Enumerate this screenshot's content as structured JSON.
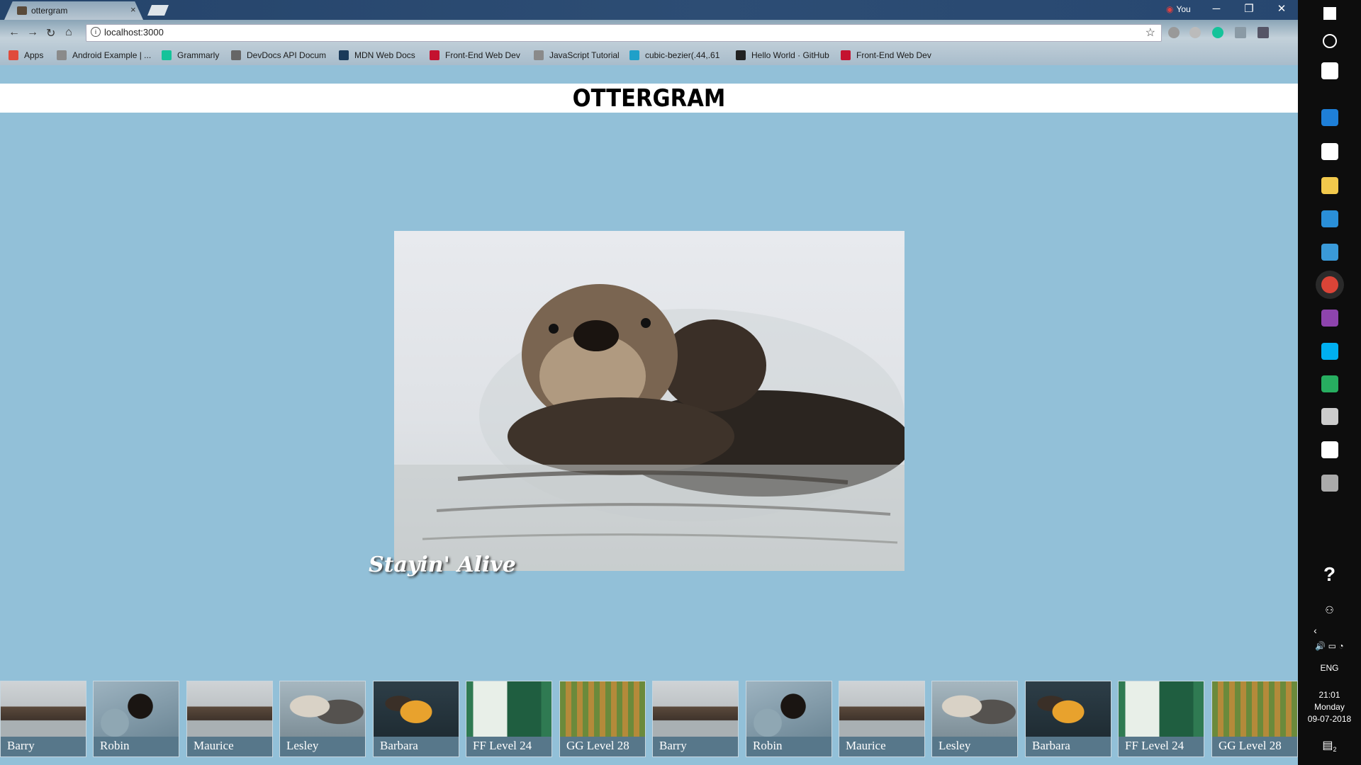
{
  "browser": {
    "tab_title": "ottergram",
    "tab_close": "×",
    "profile": "You",
    "url": "localhost:3000",
    "window_controls": [
      "─",
      "❐",
      "✕"
    ],
    "bookmarks": [
      {
        "label": "Apps",
        "icon": "apps-grid-icon",
        "color": "#e04b3c"
      },
      {
        "label": "Android Example | ...",
        "icon": "page-icon",
        "color": "#8a8a8a"
      },
      {
        "label": "Grammarly",
        "icon": "grammarly-icon",
        "color": "#15c39a"
      },
      {
        "label": "DevDocs API Docum",
        "icon": "devdocs-icon",
        "color": "#666666"
      },
      {
        "label": "MDN Web Docs",
        "icon": "mdn-icon",
        "color": "#1a3a5a"
      },
      {
        "label": "Front-End Web Dev",
        "icon": "bnr-icon",
        "color": "#c4122f"
      },
      {
        "label": "JavaScript Tutorial",
        "icon": "page-icon",
        "color": "#8a8a8a"
      },
      {
        "label": "cubic-bezier(.44,.61",
        "icon": "cubic-icon",
        "color": "#1fa0c9"
      },
      {
        "label": "Hello World · GitHub",
        "icon": "github-icon",
        "color": "#222222"
      },
      {
        "label": "Front-End Web Dev",
        "icon": "bnr-icon",
        "color": "#c4122f"
      }
    ]
  },
  "page": {
    "logo": "OTTERGRAM",
    "detail_title": "Stayin' Alive",
    "thumbnails": [
      {
        "label": "Barry",
        "photo": "otter-floating"
      },
      {
        "label": "Robin",
        "photo": "otter-on-rocks"
      },
      {
        "label": "Maurice",
        "photo": "otter-floating"
      },
      {
        "label": "Lesley",
        "photo": "otters-pair"
      },
      {
        "label": "Barbara",
        "photo": "otter-golden"
      },
      {
        "label": "FF Level 24",
        "photo": "game-screenshot-green"
      },
      {
        "label": "GG Level 28",
        "photo": "game-screenshot-grid"
      },
      {
        "label": "Barry",
        "photo": "otter-floating"
      },
      {
        "label": "Robin",
        "photo": "otter-on-rocks"
      },
      {
        "label": "Maurice",
        "photo": "otter-floating"
      },
      {
        "label": "Lesley",
        "photo": "otters-pair"
      },
      {
        "label": "Barbara",
        "photo": "otter-golden"
      },
      {
        "label": "FF Level 24",
        "photo": "game-screenshot-green"
      },
      {
        "label": "GG Level 28",
        "photo": "game-screenshot-grid"
      }
    ]
  },
  "taskbar": {
    "icons": [
      {
        "name": "windows-start-icon",
        "color": "#ffffff"
      },
      {
        "name": "cortana-icon",
        "color": "#ffffff"
      },
      {
        "name": "task-view-icon",
        "color": "#ffffff"
      },
      {
        "name": "edge-icon",
        "color": "#1e7fd8"
      },
      {
        "name": "hp-icon",
        "color": "#ffffff"
      },
      {
        "name": "file-explorer-icon",
        "color": "#f2c94c"
      },
      {
        "name": "internet-explorer-icon",
        "color": "#2a8fd8"
      },
      {
        "name": "paint-icon",
        "color": "#3a9ad9"
      },
      {
        "name": "chrome-icon",
        "color": "#db4437"
      },
      {
        "name": "app-purple-icon",
        "color": "#8e44ad"
      },
      {
        "name": "skype-icon",
        "color": "#00aff0"
      },
      {
        "name": "app-green-icon",
        "color": "#27ae60"
      },
      {
        "name": "terminal-icon",
        "color": "#cccccc"
      },
      {
        "name": "settings-icon",
        "color": "#ffffff"
      },
      {
        "name": "app-misc-icon",
        "color": "#aaaaaa"
      }
    ],
    "help_glyph": "?",
    "language": "ENG",
    "time": "21:01",
    "day": "Monday",
    "date": "09-07-2018",
    "notification_count": "2"
  }
}
